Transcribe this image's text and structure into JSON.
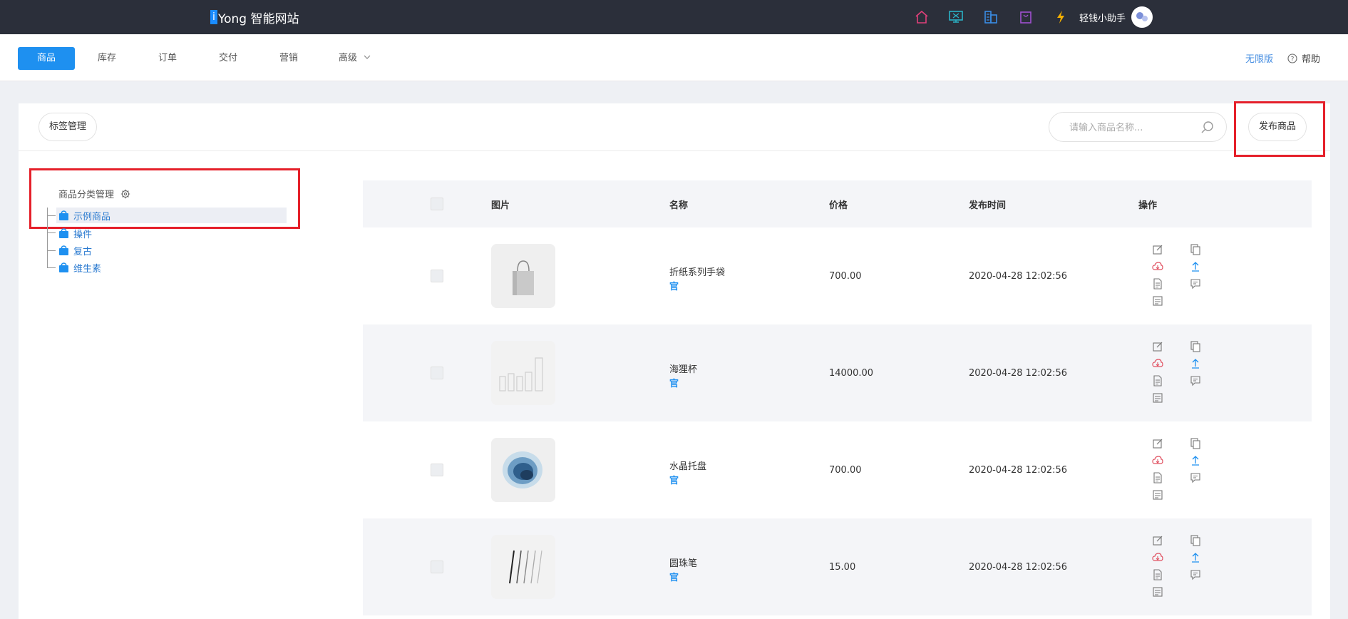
{
  "header": {
    "logo_letter": "i",
    "brand_name": "Yong 智能网站",
    "icons": [
      "home-icon",
      "monitor-icon",
      "building-icon",
      "bag-icon",
      "lightning-icon"
    ],
    "assistant_label": "轻钱小助手"
  },
  "nav": {
    "tabs": [
      {
        "label": "商品",
        "active": true
      },
      {
        "label": "库存"
      },
      {
        "label": "订单"
      },
      {
        "label": "交付"
      },
      {
        "label": "营销"
      },
      {
        "label": "高级"
      }
    ],
    "edition_label": "无限版",
    "help_label": "帮助"
  },
  "toolbar": {
    "tag_manage_label": "标签管理",
    "search_placeholder": "请输入商品名称...",
    "publish_label": "发布商品"
  },
  "category_tree": {
    "title": "商品分类管理",
    "items": [
      {
        "label": "示例商品",
        "selected": true
      },
      {
        "label": "操件"
      },
      {
        "label": "复古"
      },
      {
        "label": "维生素"
      }
    ]
  },
  "table": {
    "headers": {
      "image": "图片",
      "name": "名称",
      "price": "价格",
      "publish_time": "发布时间",
      "actions": "操作"
    },
    "rows": [
      {
        "name": "折纸系列手袋",
        "tag": "官",
        "price": "700.00",
        "publish_time": "2020-04-28 12:02:56",
        "thumb": "paper-bag"
      },
      {
        "name": "海狸杯",
        "tag": "官",
        "price": "14000.00",
        "publish_time": "2020-04-28 12:02:56",
        "thumb": "glass-cups"
      },
      {
        "name": "水晶托盘",
        "tag": "官",
        "price": "700.00",
        "publish_time": "2020-04-28 12:02:56",
        "thumb": "crystal-tray"
      },
      {
        "name": "圆珠笔",
        "tag": "官",
        "price": "15.00",
        "publish_time": "2020-04-28 12:02:56",
        "thumb": "pens"
      }
    ]
  },
  "colors": {
    "topbar": "#2b2f3a",
    "accent": "#1e90f0",
    "highlight_box": "#e5202a",
    "link_blue": "#2a7ad0"
  }
}
